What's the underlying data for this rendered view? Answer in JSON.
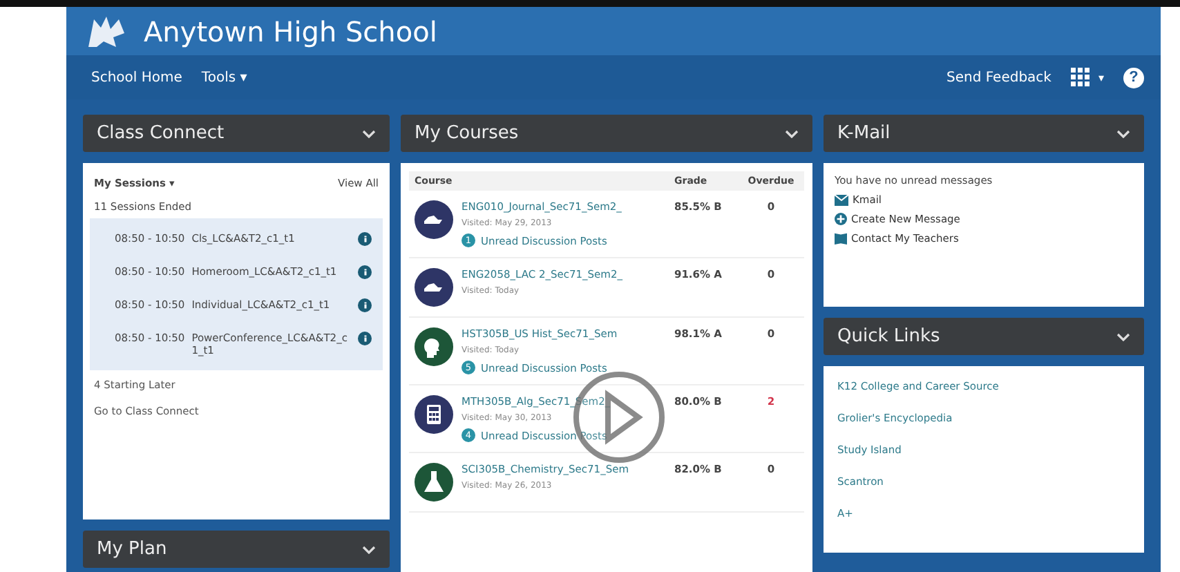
{
  "header": {
    "school_name": "Anytown High School"
  },
  "nav": {
    "items": [
      "School Home",
      "Tools ▾"
    ],
    "feedback": "Send Feedback",
    "apps_caret": "▾",
    "help": "?"
  },
  "class_connect": {
    "title": "Class Connect",
    "sessions_menu": "My Sessions ▾",
    "view_all": "View All",
    "ended": "11 Sessions Ended",
    "sessions": [
      {
        "time": "08:50 - 10:50",
        "name": "Cls_LC&A&T2_c1_t1"
      },
      {
        "time": "08:50 - 10:50",
        "name": "Homeroom_LC&A&T2_c1_t1"
      },
      {
        "time": "08:50 - 10:50",
        "name": "Individual_LC&A&T2_c1_t1"
      },
      {
        "time": "08:50 - 10:50",
        "name": "PowerConference_LC&A&T2_c1_t1"
      }
    ],
    "later": "4 Starting Later",
    "go_link": "Go to Class Connect"
  },
  "my_plan": {
    "title": "My Plan"
  },
  "my_courses": {
    "title": "My Courses",
    "columns": [
      "Course",
      "Grade",
      "Overdue"
    ],
    "rows": [
      {
        "kind": "writing",
        "color": "#2e3566",
        "name": "ENG010_Journal_Sec71_Sem2_",
        "visited": "Visited: May 29, 2013",
        "grade": "85.5% B",
        "overdue": "0",
        "late": false,
        "unread_count": "1",
        "unread_label": "Unread Discussion Posts"
      },
      {
        "kind": "writing",
        "color": "#2e3566",
        "name": "ENG2058_LAC 2_Sec71_Sem2_",
        "visited": "Visited: Today",
        "grade": "91.6% A",
        "overdue": "0",
        "late": false
      },
      {
        "kind": "head",
        "color": "#1d5638",
        "name": "HST305B_US Hist_Sec71_Sem",
        "visited": "Visited: Today",
        "grade": "98.1% A",
        "overdue": "0",
        "late": false,
        "unread_count": "5",
        "unread_label": "Unread Discussion Posts"
      },
      {
        "kind": "calculator",
        "color": "#2e3566",
        "name": "MTH305B_Alg_Sec71_Sem2_",
        "visited": "Visited: May 30, 2013",
        "grade": "80.0% B",
        "overdue": "2",
        "late": true,
        "unread_count": "4",
        "unread_label": "Unread Discussion Posts"
      },
      {
        "kind": "flask",
        "color": "#1d5638",
        "name": "SCI305B_Chemistry_Sec71_Sem",
        "visited": "Visited: May 26, 2013",
        "grade": "82.0% B",
        "overdue": "0",
        "late": false
      }
    ]
  },
  "kmail": {
    "title": "K-Mail",
    "message": "You have no unread messages",
    "links": [
      {
        "kind": "mail",
        "label": "Kmail"
      },
      {
        "kind": "plus",
        "label": "Create New Message"
      },
      {
        "kind": "book",
        "label": "Contact My Teachers"
      }
    ]
  },
  "quick_links": {
    "title": "Quick Links",
    "links": [
      "K12 College and Career Source",
      "Grolier's Encyclopedia",
      "Study Island",
      "Scantron",
      "A+"
    ]
  }
}
